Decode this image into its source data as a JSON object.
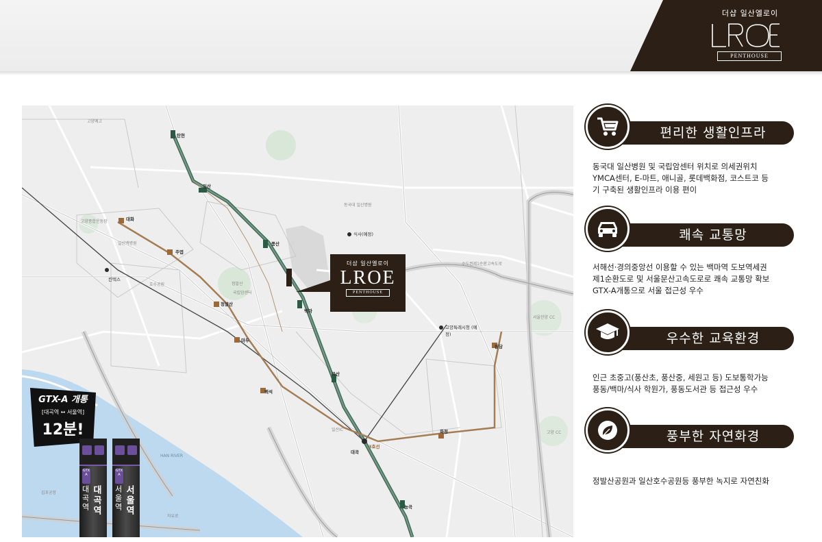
{
  "header": {
    "brand_sub": "더샵 일산엘로이",
    "brand_logo": "LROE",
    "brand_penthouse": "PENTHOUSE",
    "brand_color": "#2c1f16"
  },
  "map": {
    "site_callout": {
      "sub": "더샵 일산엘로이",
      "logo": "LROE",
      "penthouse": "PENTHOUSE"
    },
    "stations": {
      "tanhyeon": "탄현",
      "ilsan": "일산",
      "pungsan": "풍산",
      "baekma": "백마",
      "gokssan": "곡산",
      "daegok": "대곡",
      "neunggok": "능곡",
      "daehwa": "대화",
      "jueop": "주엽",
      "jeongbalsan": "정발산",
      "madu": "마두",
      "baekseok": "백석",
      "wondang": "원당",
      "hwajeong": "화정",
      "line3": "3호선",
      "sigsa": "식사(예정)",
      "goyang_hall": "고양특례시청 (예정)",
      "kintex": "킨텍스"
    },
    "places": {
      "goyang_eco": "고양예고",
      "goyang_school": "고양종합운동장",
      "hosu": "호수공원",
      "jeongbal_park": "정발산",
      "national_cancer": "국립암센터",
      "goyangsi": "고양시",
      "baekma_st": "백마역",
      "ilsan_hosp": "일산백병원",
      "han_river": "HAN RIVER",
      "seoul_cc": "서울한양 CC",
      "goyang_cc": "고양 CC",
      "gugnae": "국립암센터",
      "dongguk": "동국대 일산병원",
      "sinseo": "신도시",
      "gimpo": "김포공항",
      "jangsan": "장항IC",
      "ilsan_ic": "일산IC",
      "seoul_ring": "수도권제1순환고속도로",
      "jayuro": "자유로",
      "neunggok_st": "능곡"
    },
    "gtx": {
      "title": "GTX-A 개통",
      "route": "[대곡역 ↔ 서울역]",
      "time": "12분!"
    },
    "towers": [
      {
        "name": "대곡역",
        "name2": "대곡역",
        "badge": "GTX A"
      },
      {
        "name": "서울역",
        "name2": "서울역",
        "badge": "GTX A"
      }
    ]
  },
  "features": [
    {
      "icon": "shopping-cart-icon",
      "title": "편리한 생활인프라",
      "desc": [
        "동국대 일산병원 및 국립암센터 위치로 의세권위치",
        "YMCA센터, E-마트, 애니골, 롯데백화점, 코스트코 등",
        "기 구축된 생활인프라 이용 편이"
      ]
    },
    {
      "icon": "car-icon",
      "title": "쾌속 교통망",
      "desc": [
        "서해선·경의중앙선 이용할 수 있는 백마역 도보역세권",
        "제1순환도로 및 서울문산고속도로로 쾌속 교통망 확보",
        "GTX-A개통으로 서울 접근성 우수"
      ]
    },
    {
      "icon": "graduation-cap-icon",
      "title": "우수한 교육환경",
      "desc": [
        "인근 초중고(풍산초, 풍산중, 세원고 등) 도보통학가능",
        "풍동/백마/식사 학원가, 풍동도서관 등 접근성 우수"
      ]
    },
    {
      "icon": "leaf-icon",
      "title": "풍부한 자연화경",
      "desc": [
        "정발산공원과 일산호수공원등 풍부한 녹지로 자연친화"
      ]
    }
  ]
}
